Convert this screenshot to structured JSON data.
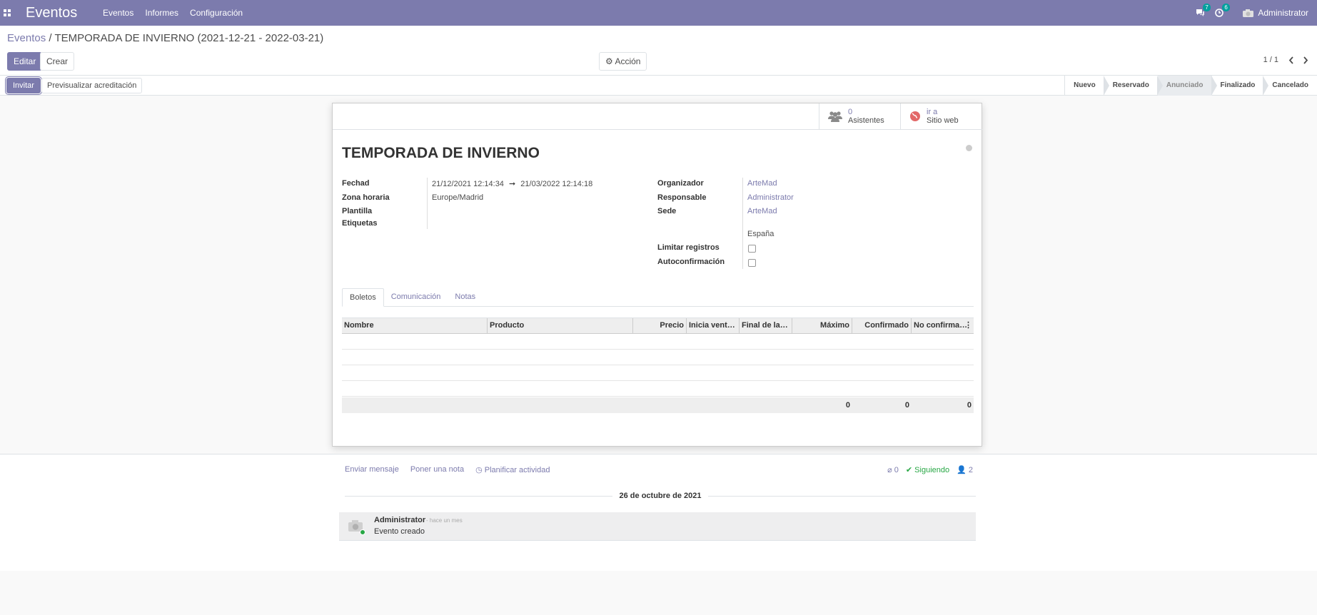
{
  "navbar": {
    "brand": "Eventos",
    "menu": [
      "Eventos",
      "Informes",
      "Configuración"
    ],
    "messages_badge": "7",
    "activities_badge": "6",
    "user": "Administrator",
    "bg_color": "#7c7bad"
  },
  "breadcrumb": {
    "parent": "Eventos",
    "separator": "/",
    "current": "TEMPORADA DE INVIERNO (2021-12-21 - 2022-03-21)"
  },
  "toolbar": {
    "edit_label": "Editar",
    "create_label": "Crear",
    "action_label": "Acción",
    "pager": "1 / 1"
  },
  "statusbar": {
    "invite_label": "Invitar",
    "preview_label": "Previsualizar acreditación",
    "stages": [
      "Nuevo",
      "Reservado",
      "Anunciado",
      "Finalizado",
      "Cancelado"
    ],
    "active_stage": "Anunciado"
  },
  "stat_buttons": {
    "attendees_count": "0",
    "attendees_label": "Asistentes",
    "website_line1": "ir a",
    "website_line2": "Sitio web"
  },
  "form": {
    "title": "TEMPORADA DE INVIERNO",
    "labels": {
      "date": "Fechad",
      "timezone": "Zona horaria",
      "template": "Plantilla",
      "tags": "Etiquetas",
      "organizer": "Organizador",
      "responsible": "Responsable",
      "venue": "Sede",
      "limit": "Limitar registros",
      "autoconfirm": "Autoconfirmación"
    },
    "values": {
      "date_begin": "21/12/2021 12:14:34",
      "date_arrow": "➞",
      "date_end": "21/03/2022 12:14:18",
      "timezone": "Europe/Madrid",
      "organizer": "ArteMad",
      "responsible": "Administrator",
      "venue": "ArteMad",
      "venue_country": "España"
    }
  },
  "tabs": [
    "Boletos",
    "Comunicación",
    "Notas"
  ],
  "ticket_table": {
    "columns": [
      "Nombre",
      "Producto",
      "Precio",
      "Inicia vent…",
      "Final de la…",
      "Máximo",
      "Confirmado",
      "No confirma…"
    ],
    "totals": [
      "0",
      "0",
      "0"
    ]
  },
  "chatter": {
    "send_message": "Enviar mensaje",
    "log_note": "Poner una nota",
    "schedule_activity": "Planificar actividad",
    "attachments": "0",
    "following": "Siguiendo",
    "followers": "2",
    "date_separator": "26 de octubre de 2021",
    "message": {
      "author": "Administrator",
      "time": "- hace un mes",
      "body": "Evento creado"
    }
  }
}
